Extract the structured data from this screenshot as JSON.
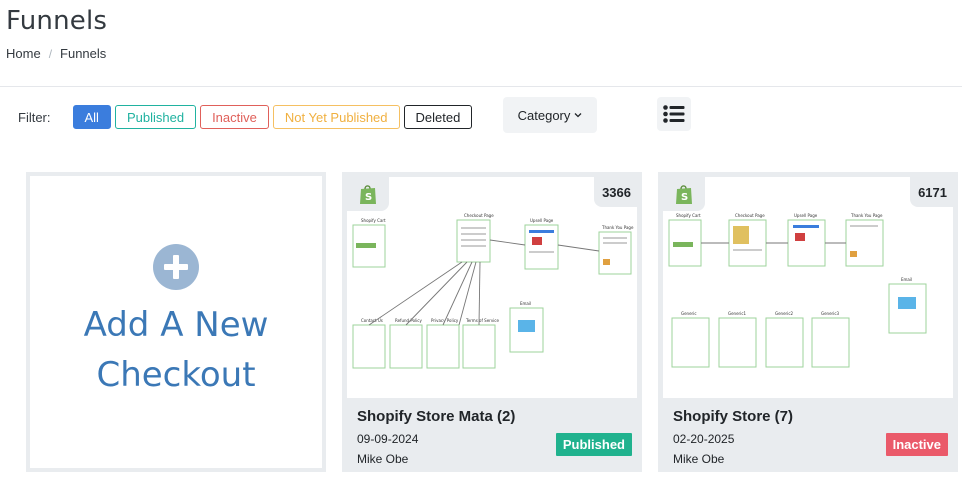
{
  "page": {
    "title": "Funnels"
  },
  "breadcrumb": {
    "home": "Home",
    "separator": "/",
    "current": "Funnels"
  },
  "filter": {
    "label": "Filter:",
    "buttons": {
      "all": "All",
      "published": "Published",
      "inactive": "Inactive",
      "not_yet_published": "Not Yet Published",
      "deleted": "Deleted"
    },
    "category": "Category",
    "list_view_icon": "list-icon"
  },
  "add_card": {
    "icon": "plus-circle-icon",
    "line1": "Add A New",
    "line2": "Checkout"
  },
  "funnels": [
    {
      "id_count": "3366",
      "title": "Shopify Store Mata (2)",
      "date": "09-09-2024",
      "owner": "Mike Obe",
      "status": "Published",
      "status_color": "#20b28e",
      "icon": "shopify-bag-icon",
      "nodes": {
        "cart": "Shopify Cart",
        "checkout": "Checkout Page",
        "upsell": "Upsell Page",
        "thankyou": "Thank You Page",
        "email": "Email",
        "contact": "Contact Us",
        "refund": "Refund Policy",
        "privacy": "Privacy Policy",
        "terms": "Terms of Service"
      }
    },
    {
      "id_count": "6171",
      "title": "Shopify Store (7)",
      "date": "02-20-2025",
      "owner": "Mike Obe",
      "status": "Inactive",
      "status_color": "#ea5a6a",
      "icon": "shopify-bag-icon",
      "nodes": {
        "cart": "Shopify Cart",
        "checkout": "Checkout Page",
        "upsell": "Upsell Page",
        "thankyou": "Thank You Page",
        "email": "Email",
        "g1": "Generic",
        "g2": "Generic1",
        "g3": "Generic2",
        "g4": "Generic3"
      }
    }
  ],
  "colors": {
    "accent": "#3b7ddd",
    "published": "#20b2a0",
    "inactive": "#e0605a",
    "not_yet": "#f0b040"
  }
}
